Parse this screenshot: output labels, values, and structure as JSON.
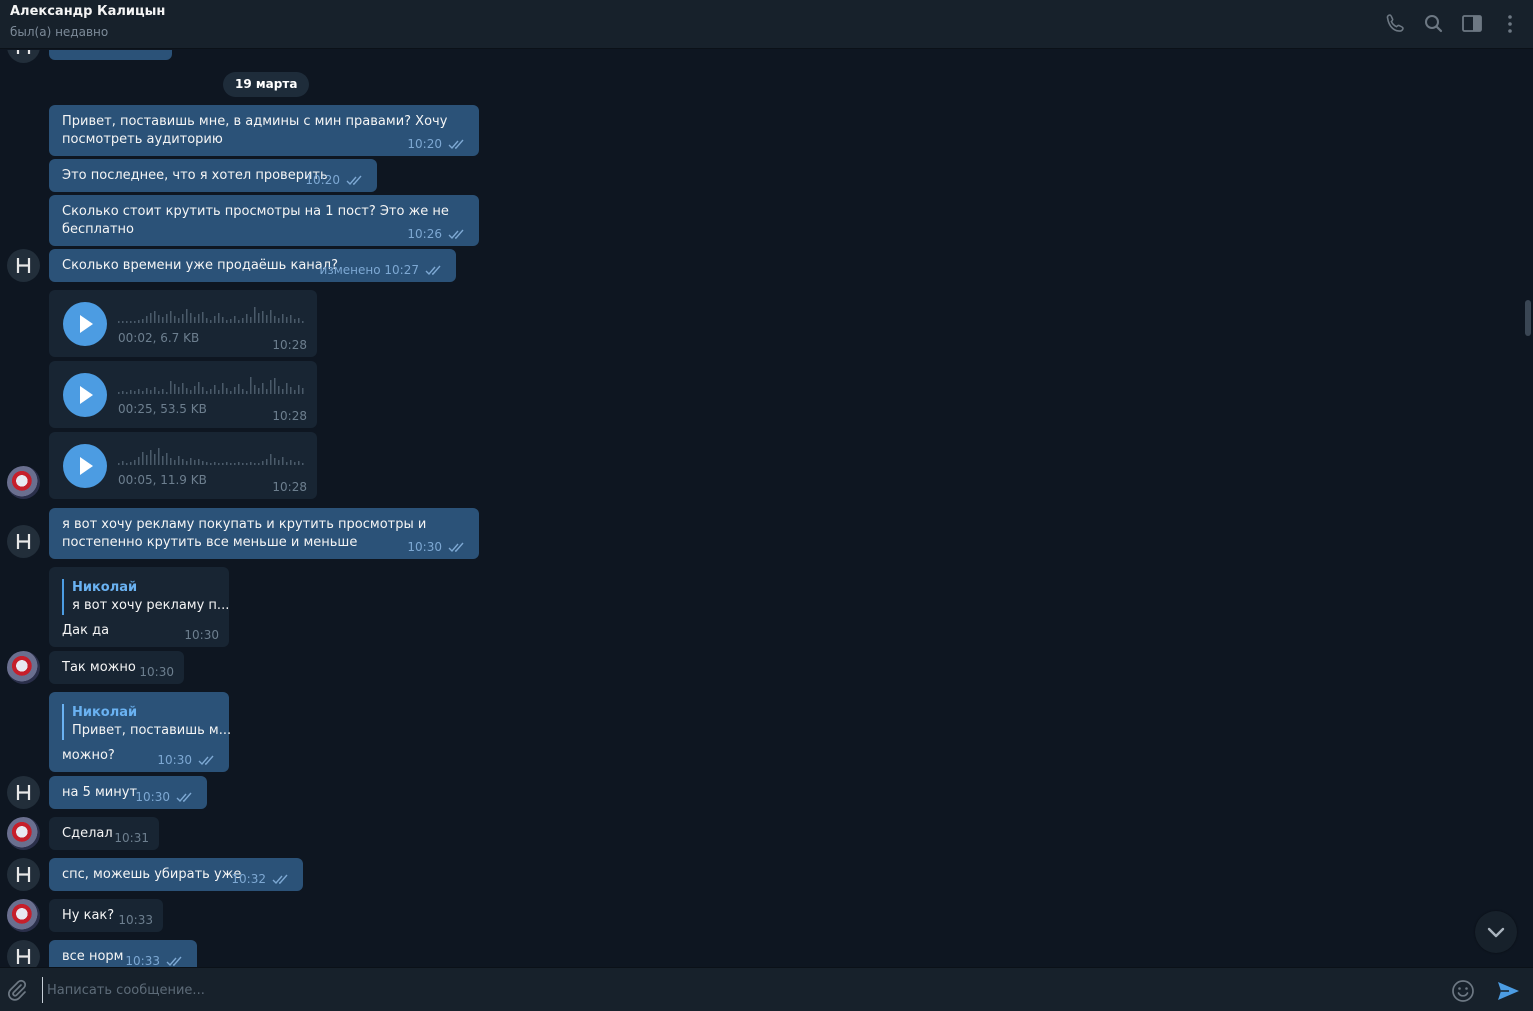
{
  "header": {
    "name": "Александр Калицын",
    "status": "был(а) недавно",
    "icons": [
      "phone-icon",
      "search-icon",
      "sidebar-toggle-icon",
      "more-vertical-icon"
    ]
  },
  "date_separator": "19 марта",
  "messages": [
    {
      "dir": "out",
      "text": "Привет, поставишь мне, в админы с мин правами? Хочу\nпосмотреть аудиторию",
      "time": "10:20"
    },
    {
      "dir": "out",
      "text": "Это последнее, что я хотел проверить",
      "time": "10:20"
    },
    {
      "dir": "out",
      "text": "Сколько стоит крутить просмотры на 1 пост? Это же не\nбесплатно",
      "time": "10:26"
    },
    {
      "dir": "out",
      "text": "Сколько времени уже продаёшь канал?",
      "time": "10:27",
      "edited": "изменено"
    },
    {
      "dir": "in",
      "type": "voice",
      "info": "00:02, 6.7 KB",
      "time": "10:28"
    },
    {
      "dir": "in",
      "type": "voice",
      "info": "00:25, 53.5 KB",
      "time": "10:28"
    },
    {
      "dir": "in",
      "type": "voice",
      "info": "00:05, 11.9 KB",
      "time": "10:28"
    },
    {
      "dir": "out",
      "text": "я вот хочу рекламу покупать и крутить просмотры и\nпостепенно крутить все меньше и меньше",
      "time": "10:30"
    },
    {
      "dir": "in",
      "reply_name": "Николай",
      "reply_text": "я вот хочу рекламу п...",
      "text": "Дак да",
      "time": "10:30"
    },
    {
      "dir": "in",
      "text": "Так можно",
      "time": "10:30"
    },
    {
      "dir": "out",
      "reply_name": "Николай",
      "reply_text": "Привет, поставишь м...",
      "text": "можно?",
      "time": "10:30"
    },
    {
      "dir": "out",
      "text": "на 5 минут",
      "time": "10:30"
    },
    {
      "dir": "in",
      "text": "Сделал",
      "time": "10:31"
    },
    {
      "dir": "out",
      "text": "спс, можешь убирать уже",
      "time": "10:32"
    },
    {
      "dir": "in",
      "text": "Ну как?",
      "time": "10:33"
    },
    {
      "dir": "out",
      "text": "все норм",
      "time": "10:33"
    }
  ],
  "composer": {
    "placeholder": "Написать сообщение..."
  },
  "colors": {
    "background": "#0e1621",
    "header": "#17212b",
    "outgoing_bubble": "#2b5278",
    "incoming_bubble": "#182533",
    "accent": "#4c9ce2"
  }
}
